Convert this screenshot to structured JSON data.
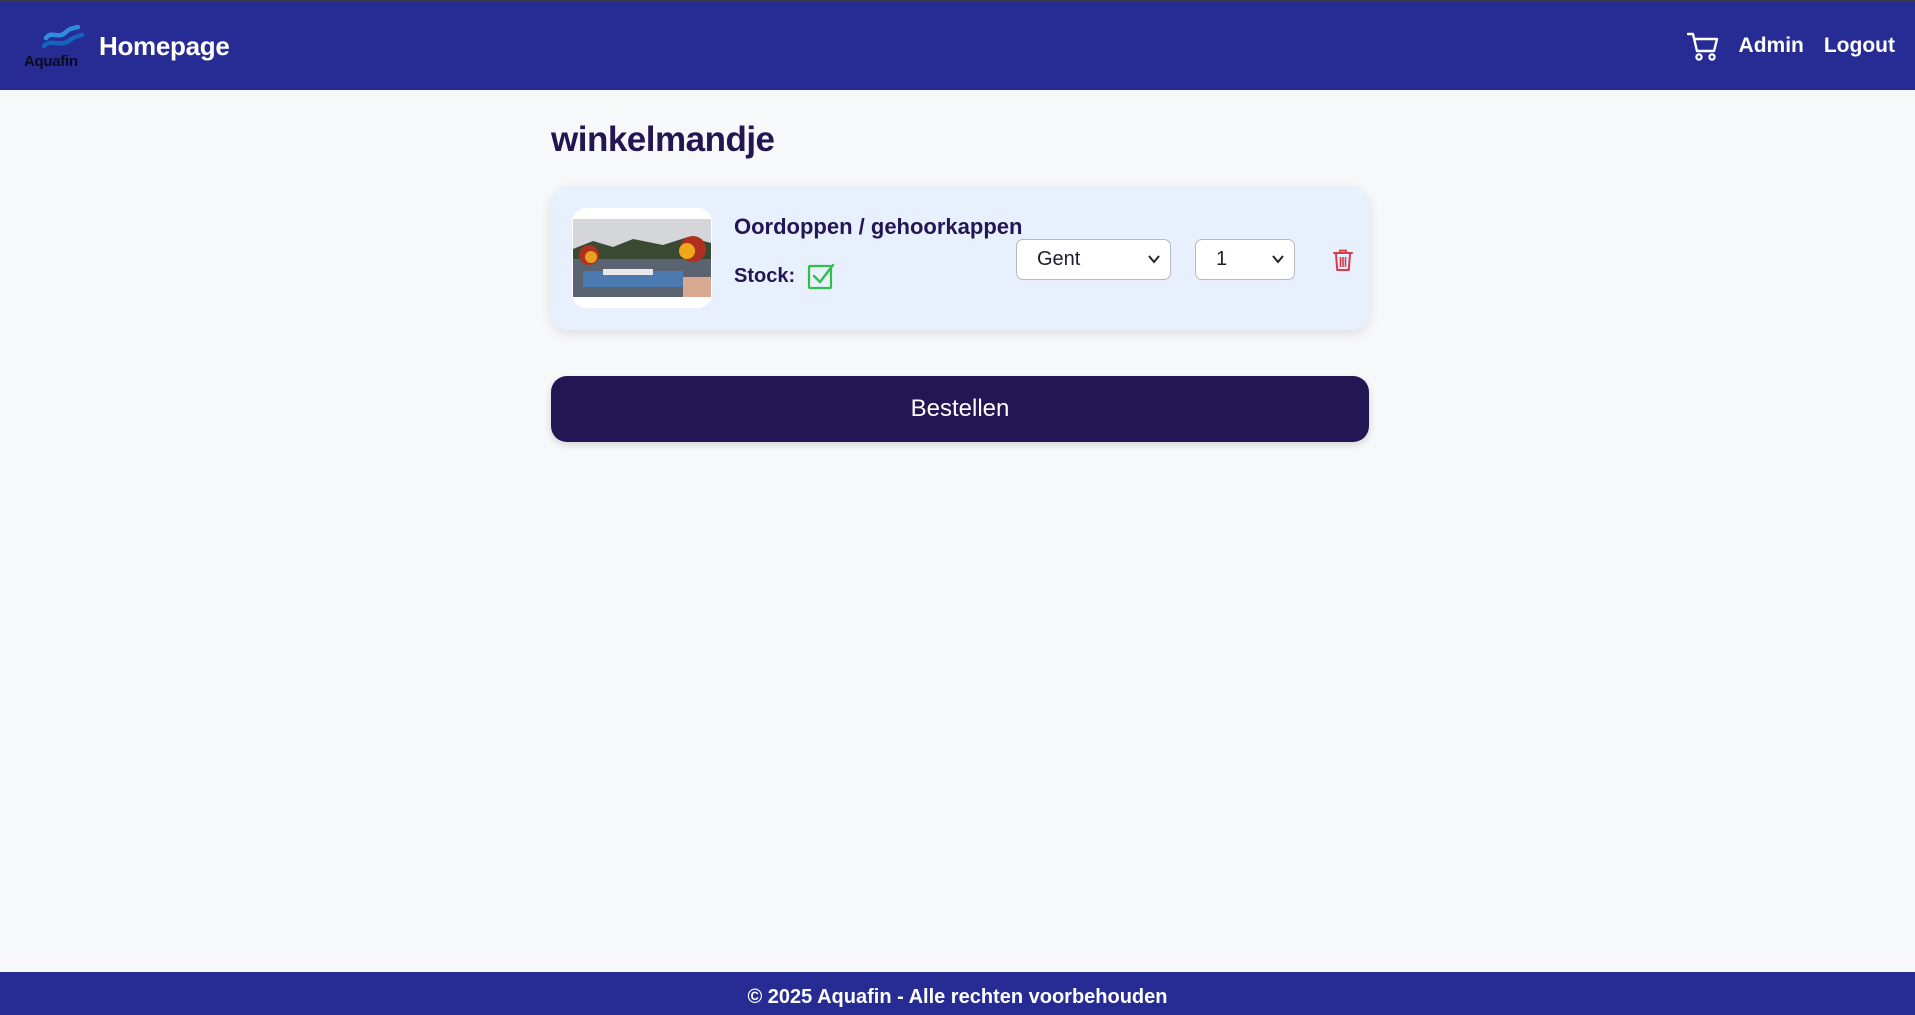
{
  "header": {
    "logo_text": "Aquafin",
    "home_label": "Homepage",
    "nav": {
      "cart_icon": "shopping-cart-icon",
      "admin_label": "Admin",
      "logout_label": "Logout"
    }
  },
  "main": {
    "title": "winkelmandje",
    "cart_items": [
      {
        "name": "Oordoppen / gehoorkappen",
        "stock_label": "Stock:",
        "stock_icon": "check-square-icon",
        "in_stock": true,
        "location": "Gent",
        "quantity": "1",
        "delete_icon": "trash-icon"
      }
    ],
    "order_button_label": "Bestellen"
  },
  "footer": {
    "text": "© 2025 Aquafin - Alle rechten voorbehouden"
  },
  "colors": {
    "navbar": "#272b94",
    "title": "#231653",
    "card_bg": "#e8f0fe",
    "button": "#231653",
    "stock_ok": "#2fbf4a",
    "delete": "#d83a4a"
  }
}
